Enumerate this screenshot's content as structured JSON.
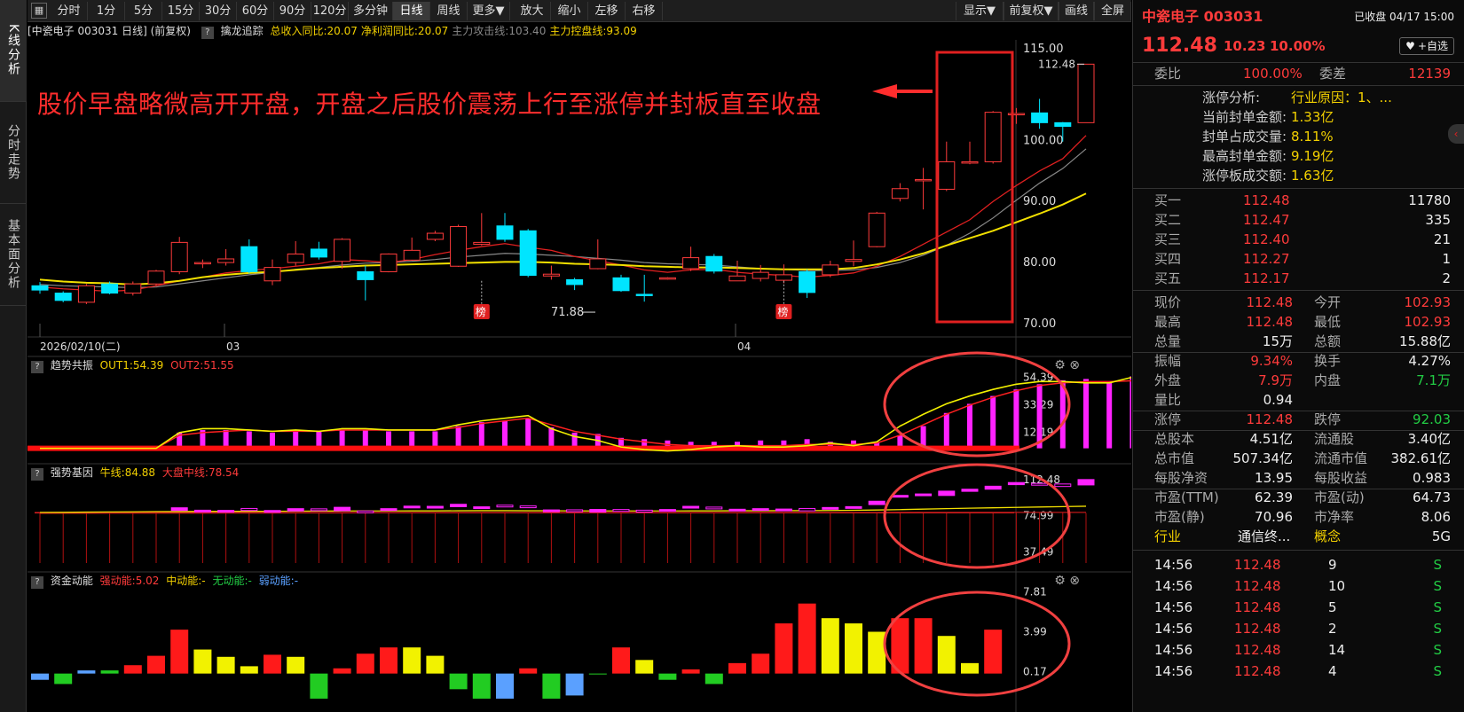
{
  "leftnav": {
    "tabs": [
      {
        "label": "K线分析",
        "active": true
      },
      {
        "label": "分时走势",
        "active": false
      },
      {
        "label": "基本面分析",
        "active": false
      }
    ]
  },
  "toolbar": {
    "periods": [
      "分时",
      "1分",
      "5分",
      "15分",
      "30分",
      "60分",
      "90分",
      "120分",
      "多分钟",
      "日线",
      "周线",
      "更多▼"
    ],
    "active_period": "日线",
    "actions": [
      "放大",
      "缩小",
      "左移",
      "右移"
    ],
    "right_actions": [
      "显示▼",
      "前复权▼",
      "画线",
      "全屏"
    ]
  },
  "kline": {
    "title": "[中瓷电子 003031 日线] (前复权)",
    "indicator_name": "擒龙追踪",
    "metrics": [
      {
        "label": "总收入同比:20.07",
        "color": "#f2d000"
      },
      {
        "label": "净利润同比:20.07",
        "color": "#f2d000"
      },
      {
        "label": "主力攻击线:103.40",
        "color": "#888888"
      },
      {
        "label": "主力控盘线:93.09",
        "color": "#f2d000"
      }
    ],
    "price_axis": [
      "115.00",
      "100.00",
      "90.00",
      "80.00",
      "70.00"
    ],
    "date_axis": [
      "2026/02/10(二)",
      "03",
      "04"
    ],
    "max_label": "112.48",
    "min_label": "71.88",
    "bang_label": "榜",
    "annotation": "股价早盘略微高开开盘，开盘之后股价震荡上行至涨停并封板直至收盘",
    "candles": [
      [
        76.2,
        75.5,
        76.8,
        74.9
      ],
      [
        75.0,
        73.8,
        75.3,
        73.5
      ],
      [
        73.5,
        76.2,
        76.5,
        73.2
      ],
      [
        76.5,
        75.0,
        76.9,
        74.8
      ],
      [
        75.0,
        76.5,
        76.9,
        74.6
      ],
      [
        76.5,
        78.6,
        78.8,
        76.2
      ],
      [
        78.5,
        83.3,
        84.2,
        78.1
      ],
      [
        79.8,
        80.0,
        80.5,
        79.1
      ],
      [
        80.0,
        80.6,
        82.2,
        79.5
      ],
      [
        82.6,
        78.5,
        83.8,
        78.2
      ],
      [
        77.0,
        79.2,
        80.5,
        76.3
      ],
      [
        80.0,
        81.4,
        83.5,
        79.5
      ],
      [
        82.2,
        80.9,
        83.4,
        80.5
      ],
      [
        80.2,
        83.8,
        84.0,
        79.0
      ],
      [
        78.5,
        77.2,
        79.5,
        73.8
      ],
      [
        78.5,
        81.4,
        81.5,
        78.4
      ],
      [
        80.4,
        82.0,
        84.1,
        80.3
      ],
      [
        83.8,
        84.8,
        85.2,
        83.5
      ],
      [
        79.4,
        85.9,
        86.2,
        79.3
      ],
      [
        83.0,
        83.3,
        88.1,
        82.8
      ],
      [
        86.0,
        83.8,
        88.1,
        83.4
      ],
      [
        85.2,
        77.9,
        85.5,
        77.6
      ],
      [
        77.8,
        78.1,
        79.5,
        77.2
      ],
      [
        77.2,
        76.4,
        77.5,
        75.5
      ],
      [
        79.0,
        80.6,
        83.8,
        78.9
      ],
      [
        77.5,
        75.4,
        78.0,
        75.2
      ],
      [
        74.8,
        74.6,
        78.0,
        73.6
      ],
      [
        77.5,
        77.5,
        77.6,
        77.2
      ],
      [
        79.0,
        80.8,
        82.6,
        78.6
      ],
      [
        81.0,
        78.6,
        81.4,
        78.2
      ],
      [
        77.0,
        77.8,
        80.3,
        77.2
      ],
      [
        77.4,
        78.4,
        79.6,
        76.9
      ],
      [
        77.1,
        78.0,
        79.7,
        76.6
      ],
      [
        78.5,
        75.1,
        78.9,
        74.2
      ],
      [
        78.0,
        79.6,
        80.3,
        77.6
      ],
      [
        80.2,
        80.5,
        83.6,
        79.4
      ],
      [
        82.6,
        88.1,
        88.3,
        82.5
      ],
      [
        90.5,
        92.1,
        93.0,
        90.0
      ],
      [
        93.5,
        93.6,
        95.5,
        88.7
      ],
      [
        92.0,
        96.5,
        99.8,
        91.7
      ],
      [
        96.3,
        96.5,
        99.8,
        96.1
      ],
      [
        96.5,
        104.6,
        104.8,
        96.2
      ],
      [
        104.2,
        104.4,
        105.3,
        102.7
      ],
      [
        104.5,
        102.9,
        106.8,
        101.9
      ],
      [
        102.9,
        102.3,
        103.0,
        99.8
      ],
      [
        102.9,
        112.48,
        112.48,
        102.93
      ]
    ],
    "ma_red": [
      76.0,
      75.7,
      75.5,
      75.3,
      75.5,
      76.2,
      77.0,
      77.6,
      78.3,
      78.7,
      79.0,
      79.4,
      79.8,
      80.5,
      80.3,
      80.0,
      80.5,
      81.3,
      82.0,
      82.6,
      83.1,
      82.5,
      82.0,
      81.0,
      80.3,
      79.6,
      78.8,
      78.4,
      78.8,
      78.9,
      78.4,
      78.1,
      77.9,
      77.6,
      77.9,
      78.3,
      79.4,
      81.0,
      83.0,
      85.0,
      87.0,
      90.0,
      92.6,
      95.0,
      97.0,
      100.8
    ],
    "ma_gray": [
      76.4,
      76.2,
      76.1,
      76.0,
      75.9,
      76.0,
      76.5,
      77.0,
      77.5,
      78.0,
      78.4,
      78.9,
      79.2,
      79.6,
      79.9,
      80.0,
      80.2,
      80.5,
      80.9,
      81.2,
      81.5,
      81.4,
      81.2,
      81.0,
      80.7,
      80.4,
      80.0,
      79.8,
      79.7,
      79.6,
      79.3,
      79.0,
      78.9,
      78.7,
      78.7,
      78.8,
      79.2,
      80.0,
      81.2,
      82.8,
      84.8,
      87.3,
      90.2,
      93.0,
      95.4,
      98.6
    ],
    "ma_yellow": [
      77.2,
      76.9,
      76.7,
      76.6,
      76.4,
      76.6,
      77.0,
      77.6,
      78.0,
      78.3,
      78.5,
      78.8,
      79.1,
      79.3,
      79.5,
      79.6,
      79.7,
      79.8,
      79.9,
      80.0,
      80.1,
      80.1,
      80.0,
      79.8,
      79.7,
      79.6,
      79.4,
      79.3,
      79.2,
      79.2,
      79.1,
      79.0,
      78.9,
      78.9,
      78.9,
      79.1,
      79.7,
      80.5,
      81.5,
      82.8,
      84.0,
      85.2,
      86.6,
      88.0,
      89.5,
      91.3,
      93.09
    ]
  },
  "trend": {
    "name": "趋势共振",
    "out1": "OUT1:54.39",
    "out2": "OUT2:51.55",
    "axis": [
      "54.39",
      "33.29",
      "12.19"
    ],
    "bars": [
      0,
      0,
      0,
      0,
      0,
      0,
      12,
      14,
      14,
      13,
      12,
      13,
      13,
      14,
      14,
      13,
      13,
      13,
      17,
      20,
      21,
      23,
      16,
      12,
      11,
      8,
      7,
      6,
      5,
      5,
      5,
      6,
      6,
      7,
      5,
      6,
      5,
      10,
      17,
      27,
      34,
      40,
      45,
      49,
      52,
      53,
      51,
      55
    ],
    "line_yellow": [
      0,
      0,
      0,
      0,
      0,
      0,
      12,
      15,
      15,
      14,
      13,
      14,
      13,
      15,
      15,
      14,
      14,
      14,
      18,
      21,
      23,
      25,
      15,
      9,
      6,
      1,
      -1,
      -2,
      -1,
      1,
      2,
      1,
      1,
      2,
      4,
      2,
      5,
      17,
      26,
      34,
      40,
      45,
      49,
      51,
      51,
      50,
      50,
      54.4
    ],
    "line_red": [
      0,
      0,
      0,
      0,
      0,
      0,
      10,
      12,
      13,
      14,
      13,
      13,
      13,
      14,
      14,
      14,
      14,
      14,
      16,
      19,
      21,
      23,
      18,
      13,
      10,
      7,
      5,
      3,
      2,
      2,
      2,
      2,
      2,
      3,
      3,
      3,
      4,
      10,
      18,
      26,
      33,
      39,
      44,
      48,
      50,
      51,
      51,
      51.6
    ]
  },
  "strength": {
    "name": "强势基因",
    "bull": "牛线:84.88",
    "market": "大盘中线:78.54",
    "axis": [
      "112.48",
      "74.99",
      "37.49"
    ],
    "candles": [
      [
        0,
        0
      ],
      [
        0,
        0
      ],
      [
        0,
        0
      ],
      [
        0,
        0
      ],
      [
        0,
        0
      ],
      [
        0,
        0
      ],
      [
        80.5,
        83.3
      ],
      [
        79.8,
        80.8
      ],
      [
        80.0,
        80.6
      ],
      [
        82.6,
        80.5
      ],
      [
        79.0,
        80.5
      ],
      [
        80.0,
        82.4
      ],
      [
        82.2,
        81.9
      ],
      [
        80.2,
        83.8
      ],
      [
        80.0,
        79.2
      ],
      [
        80.5,
        82.4
      ],
      [
        84.0,
        85.0
      ],
      [
        83.8,
        84.8
      ],
      [
        84.4,
        86.9
      ],
      [
        84.0,
        84.3
      ],
      [
        86.0,
        84.8
      ],
      [
        85.2,
        83.9
      ],
      [
        80.8,
        81.1
      ],
      [
        81.2,
        80.4
      ],
      [
        79.0,
        81.6
      ],
      [
        81.5,
        80.4
      ],
      [
        80.8,
        80.6
      ],
      [
        81.5,
        81.5
      ],
      [
        83.0,
        84.8
      ],
      [
        84.0,
        82.6
      ],
      [
        81.0,
        81.8
      ],
      [
        81.4,
        82.4
      ],
      [
        80.1,
        82.0
      ],
      [
        82.5,
        80.1
      ],
      [
        82.0,
        83.6
      ],
      [
        84.2,
        84.5
      ],
      [
        86.6,
        90.1
      ],
      [
        94.5,
        96.1
      ],
      [
        97.5,
        97.6
      ],
      [
        96.0,
        100.5
      ],
      [
        100.3,
        102.5
      ],
      [
        102.5,
        105.6
      ],
      [
        107.2,
        109.4
      ],
      [
        108.5,
        106.9
      ],
      [
        107.9,
        105.3
      ],
      [
        106.9,
        112.48
      ]
    ],
    "bull_line": [
      78.5,
      78.6,
      78.8,
      79.0,
      79.1,
      79.3,
      79.4,
      79.5,
      79.6,
      79.6,
      79.7,
      79.8,
      79.9,
      80.0,
      80.0,
      80.0,
      80.1,
      80.1,
      80.2,
      80.3,
      80.3,
      80.2,
      80.2,
      80.1,
      80.0,
      80.0,
      80.0,
      80.0,
      80.1,
      80.1,
      80.2,
      80.2,
      80.3,
      80.3,
      80.5,
      80.7,
      81.0,
      81.4,
      81.9,
      82.4,
      82.9,
      83.3,
      83.7,
      84.1,
      84.5,
      84.88
    ],
    "market_line": [
      77.5,
      77.6,
      77.6,
      77.7,
      77.7,
      77.8,
      77.8,
      77.8,
      77.9,
      77.9,
      77.9,
      78.0,
      78.0,
      78.0,
      78.1,
      78.1,
      78.1,
      78.1,
      78.2,
      78.2,
      78.2,
      78.2,
      78.2,
      78.2,
      78.3,
      78.3,
      78.3,
      78.3,
      78.3,
      78.3,
      78.3,
      78.4,
      78.4,
      78.4,
      78.4,
      78.4,
      78.4,
      78.5,
      78.5,
      78.5,
      78.5,
      78.5,
      78.5,
      78.5,
      78.54,
      78.54
    ]
  },
  "capital": {
    "name": "资金动能",
    "strong": "强动能:5.02",
    "mid": "中动能:-",
    "none": "无动能:-",
    "weak": "弱动能:-",
    "axis": [
      "7.81",
      "3.99",
      "0.17"
    ],
    "bars": [
      {
        "v": -0.6,
        "c": "#5aa0ff"
      },
      {
        "v": -1.0,
        "c": "#22cc22"
      },
      {
        "v": 0.3,
        "c": "#5aa0ff"
      },
      {
        "v": 0.3,
        "c": "#22cc22"
      },
      {
        "v": 0.8,
        "c": "#ff1a1a"
      },
      {
        "v": 1.7,
        "c": "#ff1a1a"
      },
      {
        "v": 4.2,
        "c": "#ff1a1a"
      },
      {
        "v": 2.3,
        "c": "#f2f200"
      },
      {
        "v": 1.6,
        "c": "#f2f200"
      },
      {
        "v": 0.7,
        "c": "#f2f200"
      },
      {
        "v": 1.8,
        "c": "#ff1a1a"
      },
      {
        "v": 1.6,
        "c": "#f2f200"
      },
      {
        "v": -2.4,
        "c": "#22cc22"
      },
      {
        "v": 0.5,
        "c": "#ff1a1a"
      },
      {
        "v": 1.9,
        "c": "#ff1a1a"
      },
      {
        "v": 2.5,
        "c": "#ff1a1a"
      },
      {
        "v": 2.5,
        "c": "#f2f200"
      },
      {
        "v": 1.7,
        "c": "#f2f200"
      },
      {
        "v": -1.5,
        "c": "#22cc22"
      },
      {
        "v": -2.4,
        "c": "#22cc22"
      },
      {
        "v": -2.4,
        "c": "#5aa0ff"
      },
      {
        "v": 0.5,
        "c": "#ff1a1a"
      },
      {
        "v": -2.4,
        "c": "#22cc22"
      },
      {
        "v": -2.1,
        "c": "#5aa0ff"
      },
      {
        "v": 0,
        "c": "#22cc22"
      },
      {
        "v": 2.5,
        "c": "#ff1a1a"
      },
      {
        "v": 1.3,
        "c": "#f2f200"
      },
      {
        "v": -0.6,
        "c": "#22cc22"
      },
      {
        "v": 0.4,
        "c": "#ff1a1a"
      },
      {
        "v": -1.0,
        "c": "#22cc22"
      },
      {
        "v": 1.0,
        "c": "#ff1a1a"
      },
      {
        "v": 1.9,
        "c": "#ff1a1a"
      },
      {
        "v": 4.8,
        "c": "#ff1a1a"
      },
      {
        "v": 6.7,
        "c": "#ff1a1a"
      },
      {
        "v": 5.3,
        "c": "#f2f200"
      },
      {
        "v": 4.8,
        "c": "#f2f200"
      },
      {
        "v": 4.0,
        "c": "#f2f200"
      },
      {
        "v": 5.3,
        "c": "#ff1a1a"
      },
      {
        "v": 5.3,
        "c": "#ff1a1a"
      },
      {
        "v": 3.6,
        "c": "#f2f200"
      },
      {
        "v": 1.0,
        "c": "#f2f200"
      },
      {
        "v": 4.2,
        "c": "#ff1a1a"
      }
    ]
  },
  "quote": {
    "name": "中瓷电子 003031",
    "status": "已收盘 04/17 15:00",
    "price": "112.48",
    "change": "10.23",
    "pct": "10.00%",
    "fav": "+自选",
    "weibi_label": "委比",
    "weibi": "100.00%",
    "weicha_label": "委差",
    "weicha": "12139",
    "limit_analysis": [
      {
        "k": "涨停分析:",
        "v": "行业原因：1、..."
      },
      {
        "k": "当前封单金额:",
        "v": "1.33亿"
      },
      {
        "k": "封单占成交量:",
        "v": "8.11%"
      },
      {
        "k": "最高封单金额:",
        "v": "9.19亿"
      },
      {
        "k": "涨停板成交额:",
        "v": "1.63亿"
      }
    ],
    "bids": [
      {
        "k": "买一",
        "p": "112.48",
        "v": "11780"
      },
      {
        "k": "买二",
        "p": "112.47",
        "v": "335"
      },
      {
        "k": "买三",
        "p": "112.40",
        "v": "21"
      },
      {
        "k": "买四",
        "p": "112.27",
        "v": "1"
      },
      {
        "k": "买五",
        "p": "112.17",
        "v": "2"
      }
    ],
    "stats": [
      [
        {
          "k": "现价",
          "v": "112.48",
          "c": "red"
        },
        {
          "k": "今开",
          "v": "102.93",
          "c": "red"
        }
      ],
      [
        {
          "k": "最高",
          "v": "112.48",
          "c": "red"
        },
        {
          "k": "最低",
          "v": "102.93",
          "c": "red"
        }
      ],
      [
        {
          "k": "总量",
          "v": "15万",
          "c": "white"
        },
        {
          "k": "总额",
          "v": "15.88亿",
          "c": "white"
        }
      ],
      [
        {
          "k": "振幅",
          "v": "9.34%",
          "c": "red"
        },
        {
          "k": "换手",
          "v": "4.27%",
          "c": "white"
        }
      ],
      [
        {
          "k": "外盘",
          "v": "7.9万",
          "c": "red"
        },
        {
          "k": "内盘",
          "v": "7.1万",
          "c": "green"
        }
      ],
      [
        {
          "k": "量比",
          "v": "0.94",
          "c": "white"
        },
        {
          "k": "",
          "v": "",
          "c": "white"
        }
      ],
      [
        {
          "k": "涨停",
          "v": "112.48",
          "c": "red"
        },
        {
          "k": "跌停",
          "v": "92.03",
          "c": "green"
        }
      ],
      [
        {
          "k": "总股本",
          "v": "4.51亿",
          "c": "white"
        },
        {
          "k": "流通股",
          "v": "3.40亿",
          "c": "white"
        }
      ],
      [
        {
          "k": "总市值",
          "v": "507.34亿",
          "c": "white"
        },
        {
          "k": "流通市值",
          "v": "382.61亿",
          "c": "white"
        }
      ],
      [
        {
          "k": "每股净资",
          "v": "13.95",
          "c": "white"
        },
        {
          "k": "每股收益",
          "v": "0.983",
          "c": "white"
        }
      ],
      [
        {
          "k": "市盈(TTM)",
          "v": "62.39",
          "c": "white"
        },
        {
          "k": "市盈(动)",
          "v": "64.73",
          "c": "white"
        }
      ],
      [
        {
          "k": "市盈(静)",
          "v": "70.96",
          "c": "white"
        },
        {
          "k": "市净率",
          "v": "8.06",
          "c": "white"
        }
      ],
      [
        {
          "k": "行业",
          "v": "通信终...",
          "c": "white",
          "kc": "yellow"
        },
        {
          "k": "概念",
          "v": "5G",
          "c": "white",
          "kc": "yellow"
        }
      ]
    ],
    "ticks": [
      {
        "t": "14:56",
        "p": "112.48",
        "v": "9",
        "s": "S"
      },
      {
        "t": "14:56",
        "p": "112.48",
        "v": "10",
        "s": "S"
      },
      {
        "t": "14:56",
        "p": "112.48",
        "v": "5",
        "s": "S"
      },
      {
        "t": "14:56",
        "p": "112.48",
        "v": "2",
        "s": "S"
      },
      {
        "t": "14:56",
        "p": "112.48",
        "v": "14",
        "s": "S"
      },
      {
        "t": "14:56",
        "p": "112.48",
        "v": "4",
        "s": "S"
      }
    ]
  }
}
